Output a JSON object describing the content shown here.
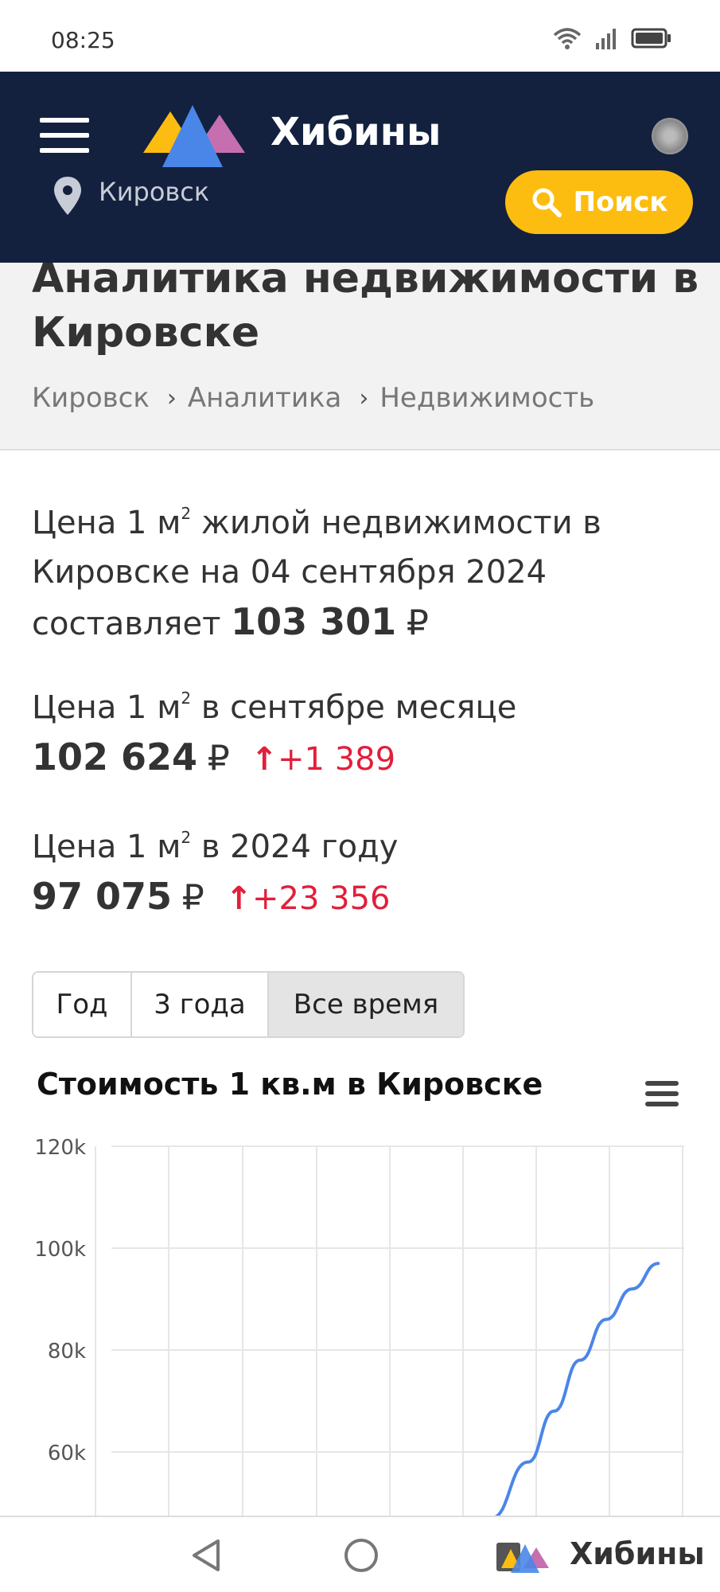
{
  "status_bar": {
    "time": "08:25"
  },
  "header": {
    "brand": "Хибины",
    "location": "Кировск",
    "search_label": "Поиск"
  },
  "page": {
    "title": "Аналитика недвижимости в Кировске",
    "breadcrumbs": [
      "Кировск",
      "Аналитика",
      "Недвижимость"
    ]
  },
  "prices": {
    "current": {
      "prefix": "Цена 1 м",
      "sup": "2",
      "text": " жилой недвижимости в Кировске на 04 сентября 2024 составляет ",
      "value": "103 301",
      "currency": "₽"
    },
    "month": {
      "prefix": "Цена 1 м",
      "sup": "2",
      "text": " в сентябре месяце",
      "value": "102 624",
      "currency": "₽",
      "delta": "+1 389"
    },
    "year": {
      "prefix": "Цена 1 м",
      "sup": "2",
      "text": " в 2024 году",
      "value": "97 075",
      "currency": "₽",
      "delta": "+23 356"
    }
  },
  "tabs": [
    {
      "label": "Год",
      "active": false
    },
    {
      "label": "3 года",
      "active": false
    },
    {
      "label": "Все время",
      "active": true
    }
  ],
  "chart_data": {
    "type": "line",
    "title": "Стоимость 1 кв.м в Кировске",
    "y_ticks": [
      "120k",
      "100k",
      "80k",
      "60k"
    ],
    "ylim": [
      60000,
      120000
    ],
    "x": [
      7.3,
      8.0,
      8.5,
      9.0,
      9.5,
      10.0,
      10.5
    ],
    "series": [
      {
        "values": [
          47000,
          58000,
          68000,
          78000,
          86000,
          92000,
          97000
        ]
      }
    ],
    "grid": true,
    "line_color": "#4a86e8"
  },
  "bottom_nav": {
    "app_name": "Хибины"
  }
}
